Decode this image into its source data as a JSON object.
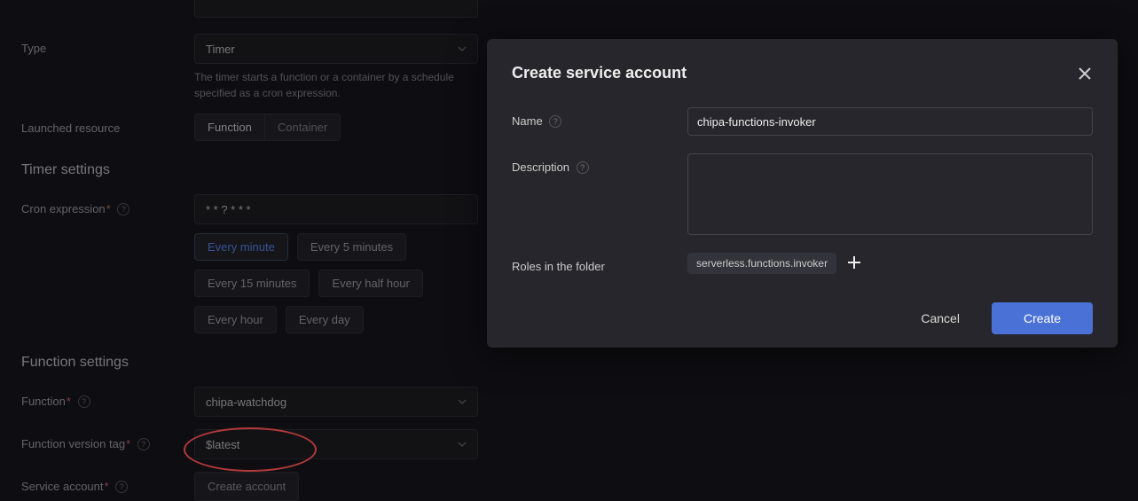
{
  "bg": {
    "type_label": "Type",
    "type_value": "Timer",
    "type_hint": "The timer starts a function or a container by a schedule specified as a cron expression.",
    "launched_label": "Launched resource",
    "launched_options": [
      "Function",
      "Container"
    ],
    "timer_heading": "Timer settings",
    "cron_label": "Cron expression",
    "cron_value": "* * ? * * *",
    "presets": [
      "Every minute",
      "Every 5 minutes",
      "Every 15 minutes",
      "Every half hour",
      "Every hour",
      "Every day"
    ],
    "func_heading": "Function settings",
    "func_label": "Function",
    "func_value": "chipa-watchdog",
    "tag_label": "Function version tag",
    "tag_value": "$latest",
    "svc_label": "Service account",
    "create_account_btn": "Create account"
  },
  "modal": {
    "title": "Create service account",
    "name_label": "Name",
    "name_value": "chipa-functions-invoker",
    "desc_label": "Description",
    "desc_value": "",
    "roles_label": "Roles in the folder",
    "role_value": "serverless.functions.invoker",
    "cancel": "Cancel",
    "create": "Create"
  }
}
